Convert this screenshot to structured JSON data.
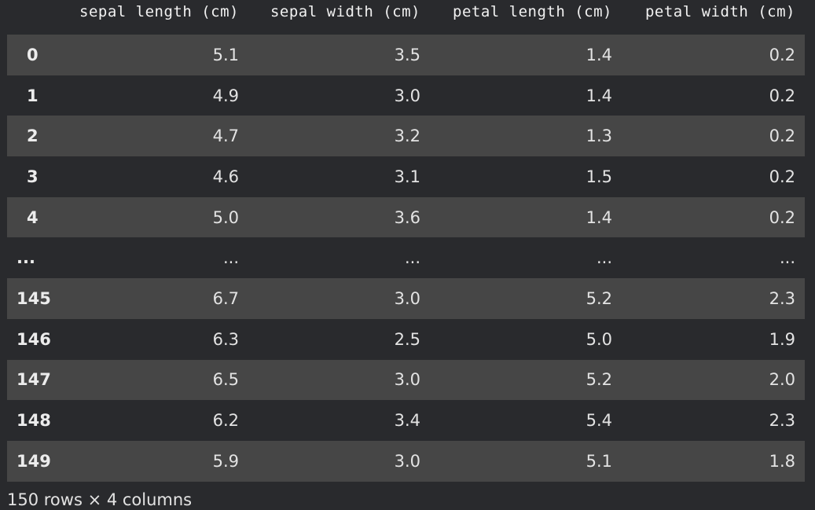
{
  "table": {
    "columns": [
      "sepal length (cm)",
      "sepal width (cm)",
      "petal length (cm)",
      "petal width (cm)"
    ],
    "rows": [
      {
        "index": "0",
        "values": [
          "5.1",
          "3.5",
          "1.4",
          "0.2"
        ]
      },
      {
        "index": "1",
        "values": [
          "4.9",
          "3.0",
          "1.4",
          "0.2"
        ]
      },
      {
        "index": "2",
        "values": [
          "4.7",
          "3.2",
          "1.3",
          "0.2"
        ]
      },
      {
        "index": "3",
        "values": [
          "4.6",
          "3.1",
          "1.5",
          "0.2"
        ]
      },
      {
        "index": "4",
        "values": [
          "5.0",
          "3.6",
          "1.4",
          "0.2"
        ]
      },
      {
        "index": "...",
        "values": [
          "...",
          "...",
          "...",
          "..."
        ]
      },
      {
        "index": "145",
        "values": [
          "6.7",
          "3.0",
          "5.2",
          "2.3"
        ]
      },
      {
        "index": "146",
        "values": [
          "6.3",
          "2.5",
          "5.0",
          "1.9"
        ]
      },
      {
        "index": "147",
        "values": [
          "6.5",
          "3.0",
          "5.2",
          "2.0"
        ]
      },
      {
        "index": "148",
        "values": [
          "6.2",
          "3.4",
          "5.4",
          "2.3"
        ]
      },
      {
        "index": "149",
        "values": [
          "5.9",
          "3.0",
          "5.1",
          "1.8"
        ]
      }
    ]
  },
  "footer": {
    "shape_text": "150 rows × 4 columns"
  },
  "colors": {
    "background": "#292a2d",
    "striped_row": "#464646",
    "text": "#e3e3e3"
  }
}
